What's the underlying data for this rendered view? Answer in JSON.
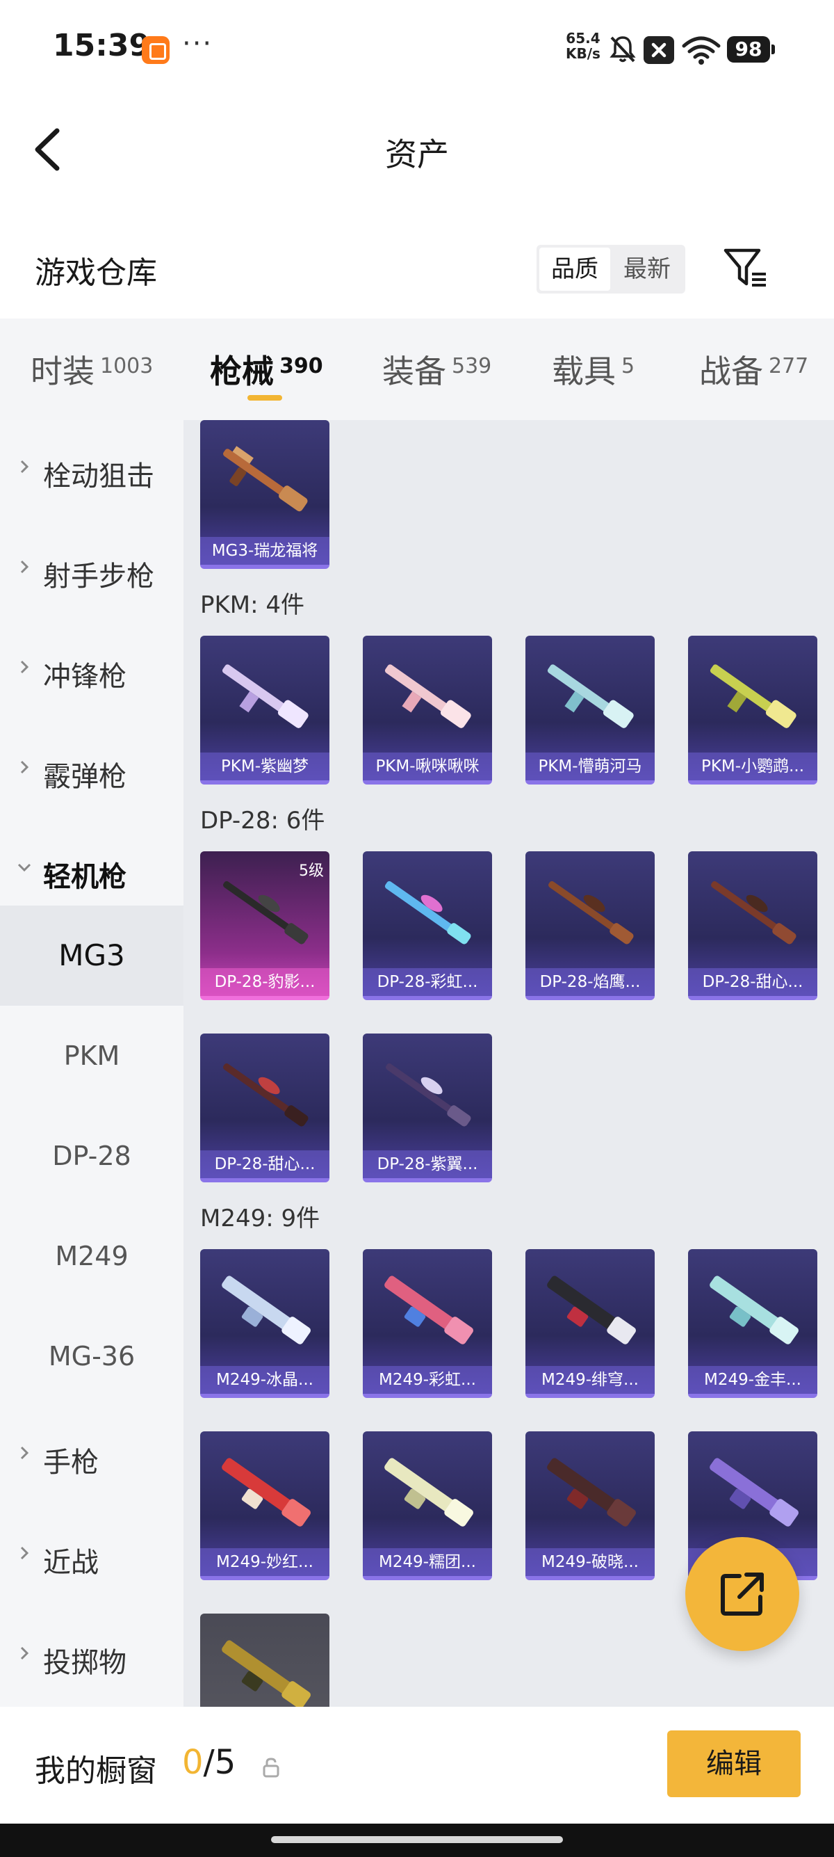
{
  "status_bar": {
    "time": "15:39",
    "net_speed_value": "65.4",
    "net_speed_unit": "KB/s",
    "battery": "98"
  },
  "header": {
    "title": "资产"
  },
  "warehouse": {
    "title": "游戏仓库",
    "sort_options": [
      "品质",
      "最新"
    ],
    "active_sort": "品质"
  },
  "tabs": [
    {
      "label": "时装",
      "count": "1003"
    },
    {
      "label": "枪械",
      "count": "390",
      "active": true
    },
    {
      "label": "装备",
      "count": "539"
    },
    {
      "label": "载具",
      "count": "5"
    },
    {
      "label": "战备",
      "count": "277"
    }
  ],
  "sidebar": {
    "categories": [
      "栓动狙击",
      "射手步枪",
      "冲锋枪",
      "霰弹枪",
      "轻机枪",
      "手枪",
      "近战",
      "投掷物"
    ],
    "open_category": "轻机枪",
    "subitems": [
      "MG3",
      "PKM",
      "DP-28",
      "M249",
      "MG-36"
    ],
    "active_subitem": "MG3"
  },
  "groups": [
    {
      "title": "",
      "items": [
        {
          "name": "MG3-瑞龙福将"
        }
      ]
    },
    {
      "title": "PKM: 4件",
      "items": [
        {
          "name": "PKM-紫幽梦"
        },
        {
          "name": "PKM-啾咪啾咪"
        },
        {
          "name": "PKM-懵萌河马"
        },
        {
          "name": "PKM-小鹦鹉..."
        }
      ]
    },
    {
      "title": "DP-28: 6件",
      "items": [
        {
          "name": "DP-28-豹影...",
          "level": "5级"
        },
        {
          "name": "DP-28-彩虹..."
        },
        {
          "name": "DP-28-焰鹰..."
        },
        {
          "name": "DP-28-甜心..."
        },
        {
          "name": "DP-28-甜心..."
        },
        {
          "name": "DP-28-紫翼..."
        }
      ]
    },
    {
      "title": "M249: 9件",
      "items": [
        {
          "name": "M249-冰晶..."
        },
        {
          "name": "M249-彩虹..."
        },
        {
          "name": "M249-绯穹..."
        },
        {
          "name": "M249-金丰..."
        },
        {
          "name": "M249-妙红..."
        },
        {
          "name": "M249-糯团..."
        },
        {
          "name": "M249-破晓..."
        },
        {
          "name": "..."
        },
        {
          "name": ""
        }
      ]
    }
  ],
  "bottom_bar": {
    "label": "我的橱窗",
    "current": "0",
    "total": "/5",
    "edit_label": "编辑"
  },
  "colors": {
    "accent": "#f3b63a",
    "card_bg": "#2c2a5c",
    "card_pink": "#c745b8"
  }
}
